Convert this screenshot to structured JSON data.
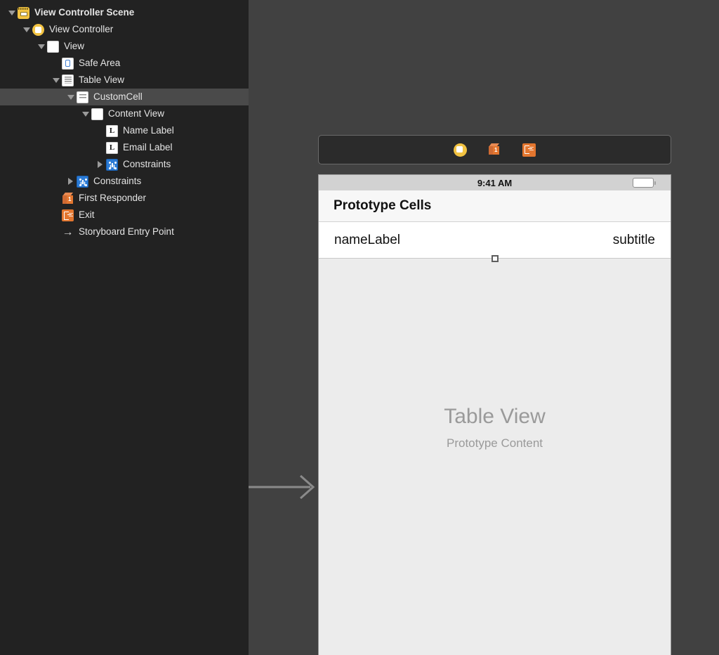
{
  "outline": {
    "name": "document-outline",
    "rows": [
      {
        "label": "View Controller Scene",
        "icon": "scene-icon",
        "depth": 0,
        "disclosure": "down",
        "bold": true,
        "selected": false
      },
      {
        "label": "View Controller",
        "icon": "view-controller-icon",
        "depth": 1,
        "disclosure": "down",
        "bold": false,
        "selected": false
      },
      {
        "label": "View",
        "icon": "view-icon",
        "depth": 2,
        "disclosure": "down",
        "bold": false,
        "selected": false
      },
      {
        "label": "Safe Area",
        "icon": "safe-area-icon",
        "depth": 3,
        "disclosure": "none",
        "bold": false,
        "selected": false
      },
      {
        "label": "Table View",
        "icon": "table-view-icon",
        "depth": 3,
        "disclosure": "down",
        "bold": false,
        "selected": false
      },
      {
        "label": "CustomCell",
        "icon": "table-cell-icon",
        "depth": 4,
        "disclosure": "down",
        "bold": false,
        "selected": true
      },
      {
        "label": "Content View",
        "icon": "view-icon",
        "depth": 5,
        "disclosure": "down",
        "bold": false,
        "selected": false
      },
      {
        "label": "Name Label",
        "icon": "label-icon",
        "depth": 6,
        "disclosure": "none",
        "bold": false,
        "selected": false
      },
      {
        "label": "Email Label",
        "icon": "label-icon",
        "depth": 6,
        "disclosure": "none",
        "bold": false,
        "selected": false
      },
      {
        "label": "Constraints",
        "icon": "constraints-icon",
        "depth": 6,
        "disclosure": "right",
        "bold": false,
        "selected": false
      },
      {
        "label": "Constraints",
        "icon": "constraints-icon",
        "depth": 4,
        "disclosure": "right",
        "bold": false,
        "selected": false
      },
      {
        "label": "First Responder",
        "icon": "first-responder-icon",
        "depth": 3,
        "disclosure": "none",
        "bold": false,
        "selected": false
      },
      {
        "label": "Exit",
        "icon": "exit-icon",
        "depth": 3,
        "disclosure": "none",
        "bold": false,
        "selected": false
      },
      {
        "label": "Storyboard Entry Point",
        "icon": "entry-point-icon",
        "depth": 3,
        "disclosure": "none",
        "bold": false,
        "selected": false
      }
    ]
  },
  "canvas": {
    "dock": {
      "items": [
        {
          "icon": "view-controller-icon",
          "name": "dock-view-controller"
        },
        {
          "icon": "first-responder-icon",
          "name": "dock-first-responder"
        },
        {
          "icon": "exit-icon",
          "name": "dock-exit"
        }
      ]
    },
    "device": {
      "status_bar": {
        "time": "9:41 AM",
        "battery": "full"
      },
      "nav_title": "Prototype Cells",
      "prototype_cell": {
        "name_label": "nameLabel",
        "detail_label": "subtitle"
      },
      "table_view_placeholder": {
        "title": "Table View",
        "subtitle": "Prototype Content"
      }
    }
  },
  "colors": {
    "sidebar_bg": "#222222",
    "canvas_bg": "#414141",
    "selection": "#4a4a4a",
    "accent_yellow": "#f2c342",
    "accent_orange": "#e3762f",
    "accent_blue": "#2b7bd6",
    "device_bg": "#ececec"
  }
}
